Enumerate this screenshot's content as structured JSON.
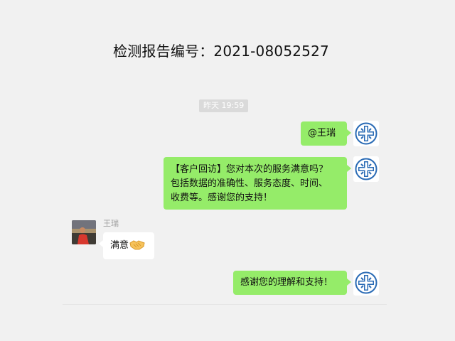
{
  "title": "检测报告编号：2021-08052527",
  "timestamp": "昨天 19:59",
  "messages": {
    "m1": "@王瑞",
    "m2_line1": "【客户回访】您对本次的服务满意吗？",
    "m2_line2": "包括数据的准确性、服务态度、时间、",
    "m2_line3": "收费等。感谢您的支持！",
    "m3_sender": "王瑞",
    "m3_text": "满意",
    "m4": "感谢您的理解和支持！"
  },
  "icons": {
    "company_avatar": "company-logo-icon",
    "reaction_emoji": "handshake-icon"
  },
  "colors": {
    "page_background": "#f1f1f1",
    "sent_bubble": "#95ec69",
    "received_bubble": "#ffffff",
    "logo_blue": "#2a6bb5"
  }
}
